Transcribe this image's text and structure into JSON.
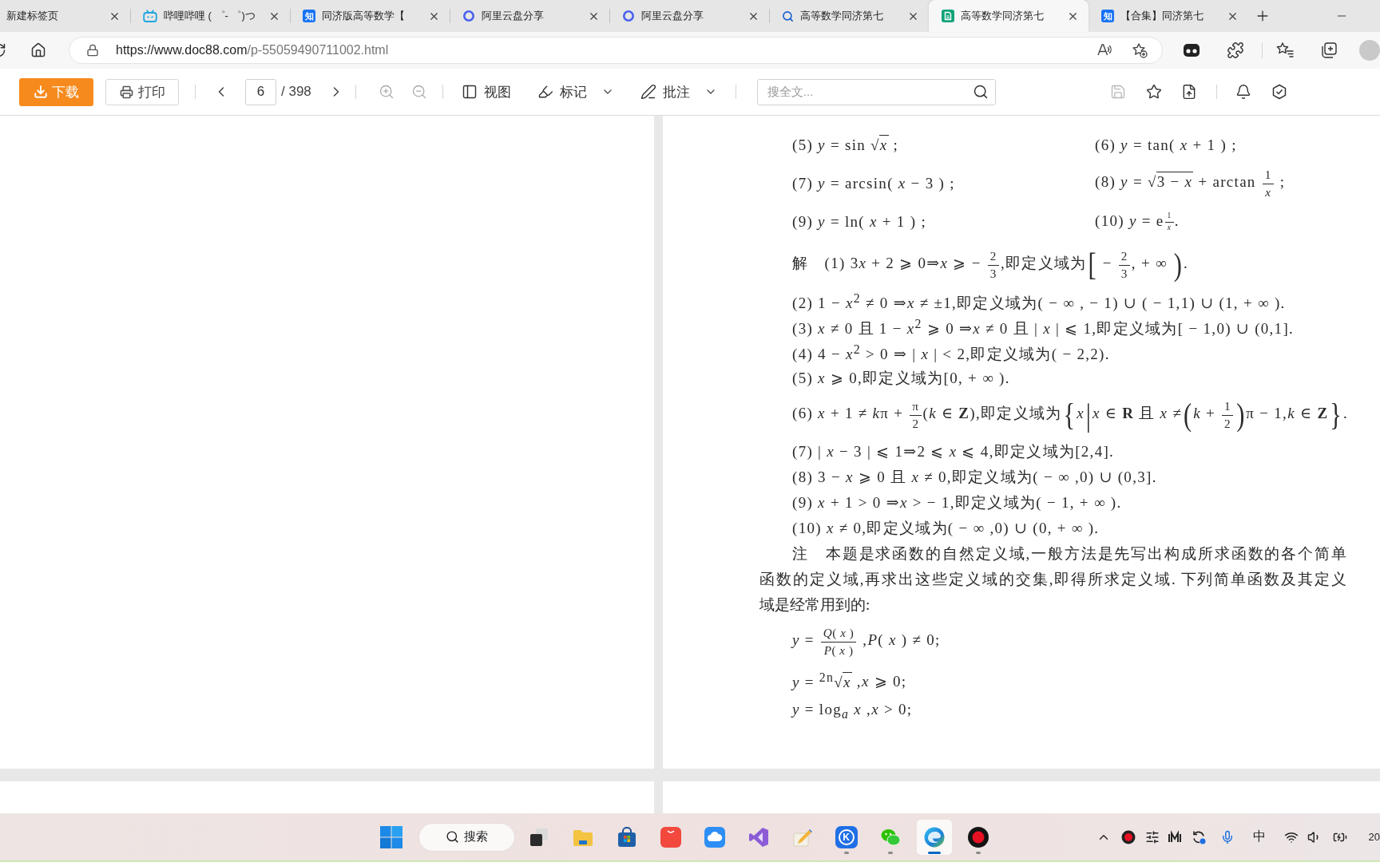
{
  "tabs": [
    {
      "kind": "none",
      "title": "新建标签页",
      "selected": false
    },
    {
      "kind": "tv",
      "title": "哔哩哔哩 ( ゜- ゜)つ",
      "selected": false
    },
    {
      "kind": "letter",
      "badge": "知",
      "title": "同济版高等数学【",
      "selected": false
    },
    {
      "kind": "ring",
      "title": "阿里云盘分享",
      "selected": false
    },
    {
      "kind": "ring",
      "title": "阿里云盘分享",
      "selected": false
    },
    {
      "kind": "search",
      "title": "高等数学同济第七",
      "selected": false
    },
    {
      "kind": "doc",
      "title": "高等数学同济第七",
      "selected": true
    },
    {
      "kind": "letter",
      "badge": "知",
      "title": "【合集】同济第七",
      "selected": false
    }
  ],
  "address_bar": {
    "url_host": "https://www.doc88.com",
    "url_path": "/p-55059490711002.html"
  },
  "viewer_toolbar": {
    "download": "下载",
    "print": "打印",
    "page": "6",
    "page_total": "/ 398",
    "menus": [
      {
        "kind": "view",
        "label": "视图",
        "dropdown": false
      },
      {
        "kind": "mark",
        "label": "标记",
        "dropdown": true
      },
      {
        "kind": "note",
        "label": "批注",
        "dropdown": true
      }
    ],
    "search": {
      "placeholder": "搜全文..."
    }
  },
  "document": {
    "exercises": [
      {
        "left": [
          {
            "kind": "text",
            "text": "(5) *y* = sin √"
          },
          {
            "kind": "over",
            "text": "*x*"
          },
          {
            "kind": "text",
            "text": " ;"
          }
        ],
        "right": [
          {
            "kind": "text",
            "text": "(6) *y* = tan( *x* + 1 ) ;"
          }
        ]
      },
      {
        "left": [
          {
            "kind": "text",
            "text": "(7) *y* = arcsin( *x* − 3 ) ;"
          }
        ],
        "right": [
          {
            "kind": "text",
            "text": "(8) *y* = √"
          },
          {
            "kind": "over",
            "text": "3 − *x*"
          },
          {
            "kind": "text",
            "text": " + arctan "
          },
          {
            "kind": "frac",
            "num": "1",
            "den": "*x*"
          },
          {
            "kind": "text",
            "text": " ;"
          }
        ]
      },
      {
        "left": [
          {
            "kind": "text",
            "text": "(9) *y* = ln( *x* + 1 ) ;"
          }
        ],
        "right": [
          {
            "kind": "text",
            "text": "(10) *y* = e"
          },
          {
            "kind": "exp",
            "num": "1",
            "den": "*x*"
          },
          {
            "kind": "text",
            "text": "."
          }
        ]
      }
    ],
    "solutions": [
      [
        {
          "kind": "text",
          "text": "解　(1) 3"
        },
        {
          "kind": "text",
          "text": "*x* + 2 ⩾ 0⇒*x* ⩾ − "
        },
        {
          "kind": "frac",
          "num": "2",
          "den": "3"
        },
        {
          "kind": "text",
          "text": ",即定义域为"
        },
        {
          "kind": "big",
          "text": "["
        },
        {
          "kind": "text",
          "text": " − "
        },
        {
          "kind": "frac",
          "num": "2",
          "den": "3"
        },
        {
          "kind": "text",
          "text": ", + ∞ "
        },
        {
          "kind": "big",
          "text": ")"
        },
        {
          "kind": "text",
          "text": "."
        }
      ],
      [
        {
          "kind": "text",
          "text": "(2) 1 − *x*$^{2}$ ≠ 0 ⇒*x* ≠ ±1,即定义域为( − ∞ , − 1) ∪ ( − 1,1) ∪ (1, + ∞ )."
        }
      ],
      [
        {
          "kind": "text",
          "text": "(3) *x* ≠ 0 且 1 − *x*$^{2}$ ⩾ 0 ⇒*x* ≠ 0 且 | *x* | ⩽ 1,即定义域为[ − 1,0) ∪ (0,1]."
        }
      ],
      [
        {
          "kind": "text",
          "text": "(4) 4 − *x*$^{2}$ > 0 ⇒ | *x* | < 2,即定义域为( − 2,2)."
        }
      ],
      [
        {
          "kind": "text",
          "text": "(5) *x* ⩾ 0,即定义域为[0, + ∞ )."
        }
      ],
      [
        {
          "kind": "text",
          "text": "(6) *x* + 1 ≠ "
        },
        {
          "kind": "text",
          "text": "*k*"
        },
        {
          "kind": "text",
          "text": "π + "
        },
        {
          "kind": "frac",
          "num": "π",
          "den": "2"
        },
        {
          "kind": "text",
          "text": "(*k* ∈ **Z**),即定义域为"
        },
        {
          "kind": "big",
          "text": "{"
        },
        {
          "kind": "text",
          "text": "*x*"
        },
        {
          "kind": "big",
          "text": "|"
        },
        {
          "kind": "text",
          "text": "*x* ∈ **R** 且 *x* ≠"
        },
        {
          "kind": "big",
          "text": "("
        },
        {
          "kind": "text",
          "text": "*k* + "
        },
        {
          "kind": "frac",
          "num": "1",
          "den": "2"
        },
        {
          "kind": "big",
          "text": ")"
        },
        {
          "kind": "text",
          "text": "π − 1,*k* ∈ **Z**"
        },
        {
          "kind": "big",
          "text": "}"
        },
        {
          "kind": "text",
          "text": "."
        }
      ],
      [
        {
          "kind": "text",
          "text": "(7) | *x* − 3 | ⩽ 1⇒2 ⩽ *x* ⩽ 4,即定义域为[2,4]."
        }
      ],
      [
        {
          "kind": "text",
          "text": "(8) 3 − *x* ⩾ 0 且 *x* ≠ 0,即定义域为( − ∞ ,0) ∪ (0,3]."
        }
      ],
      [
        {
          "kind": "text",
          "text": "(9) *x* + 1 > 0 ⇒*x* > − 1,即定义域为( − 1, + ∞ )."
        }
      ],
      [
        {
          "kind": "text",
          "text": "(10) *x* ≠ 0,即定义域为( − ∞ ,0) ∪ (0, + ∞ )."
        }
      ]
    ],
    "note": {
      "lines": [
        "注　本题是求函数的自然定义域,一般方法是先写出构成所求函数的各个简单",
        "函数的定义域,再求出这些定义域的交集,即得所求定义域. 下列简单函数及其定义",
        "域是经常用到的:"
      ]
    },
    "formulas": [
      [
        {
          "kind": "text",
          "text": "*y* = "
        },
        {
          "kind": "frac",
          "num": "*Q*( *x* )",
          "den": "*P*( *x* )"
        },
        {
          "kind": "text",
          "text": " ,*P*( *x* ) ≠ 0;"
        }
      ],
      [
        {
          "kind": "text",
          "text": "*y* = $^{2n}$√"
        },
        {
          "kind": "over",
          "text": "*x*"
        },
        {
          "kind": "text",
          "text": " ,*x* ⩾ 0;"
        }
      ],
      [
        {
          "kind": "text",
          "text": "*y* = log$_{a}$ *x* ,*x* > 0;"
        }
      ]
    ]
  },
  "taskbar": {
    "search": "搜索",
    "apps": [
      {
        "kind": "taskview",
        "running": false,
        "selected": false
      },
      {
        "kind": "folder",
        "running": false,
        "selected": false
      },
      {
        "kind": "store",
        "running": false,
        "selected": false
      },
      {
        "kind": "redtile",
        "running": false,
        "selected": false
      },
      {
        "kind": "cloud",
        "running": false,
        "selected": false
      },
      {
        "kind": "ribbon",
        "running": false,
        "selected": false
      },
      {
        "kind": "pencil",
        "running": false,
        "selected": false
      },
      {
        "kind": "letter",
        "letter": "K",
        "running": true,
        "selected": false
      },
      {
        "kind": "chat",
        "running": true,
        "selected": false
      },
      {
        "kind": "browser",
        "running": true,
        "selected": true
      },
      {
        "kind": "record",
        "running": true,
        "selected": false
      }
    ],
    "ime": "中",
    "clock": "20"
  }
}
